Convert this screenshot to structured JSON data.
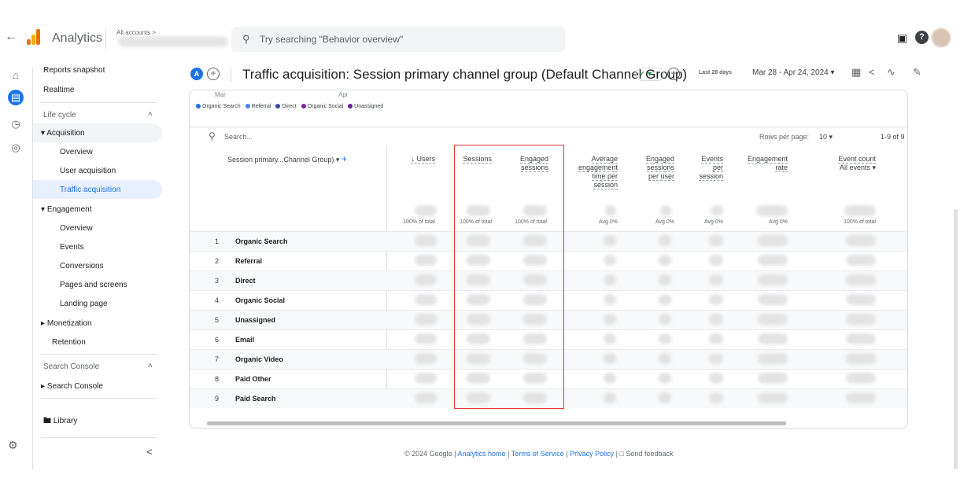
{
  "topbar": {
    "back": "←",
    "app_title": "Analytics",
    "accounts_label": "All accounts >",
    "search_placeholder": "Try searching \"Behavior overview\"",
    "search_icon": "search-icon",
    "help": "?"
  },
  "rail": {
    "icons": [
      "home-icon",
      "reports-icon",
      "explore-icon",
      "advertising-icon"
    ],
    "settings_icon": "gear-icon"
  },
  "sidenav": {
    "reports_snapshot": "Reports snapshot",
    "realtime": "Realtime",
    "lifecycle": "Life cycle",
    "acquisition": "Acquisition",
    "acq_overview": "Overview",
    "user_acquisition": "User acquisition",
    "traffic_acquisition": "Traffic acquisition",
    "engagement": "Engagement",
    "eng_overview": "Overview",
    "events": "Events",
    "conversions": "Conversions",
    "pages_and_screens": "Pages and screens",
    "landing_page": "Landing page",
    "monetization": "Monetization",
    "retention": "Retention",
    "search_console_head": "Search Console",
    "search_console": "Search Console",
    "library": "Library",
    "collapse": "<"
  },
  "header": {
    "badge": "A",
    "title": "Traffic acquisition: Session primary channel group (Default Channel Group)",
    "date_label": "Last 28 days",
    "date_range": "Mar 28 - Apr 24, 2024",
    "tools": [
      "edit-report-icon",
      "share-icon",
      "insights-icon",
      "pencil-icon"
    ]
  },
  "chart": {
    "x_ticks": [
      "Mar",
      "Apr"
    ],
    "legend": [
      {
        "label": "Organic Search",
        "color": "#1a73e8"
      },
      {
        "label": "Referral",
        "color": "#4285f4"
      },
      {
        "label": "Direct",
        "color": "#3949ab"
      },
      {
        "label": "Organic Social",
        "color": "#7b1fa2"
      },
      {
        "label": "Unassigned",
        "color": "#6a1b9a"
      }
    ]
  },
  "table": {
    "search_placeholder": "Search...",
    "rows_per_page_label": "Rows per page:",
    "rows_per_page_value": "10",
    "pagination": "1-9 of 9",
    "dimension_header": "Session primary...Channel Group)",
    "columns": {
      "users": "↓ Users",
      "sessions": "Sessions",
      "engaged_sessions": "Engaged sessions",
      "avg_engagement": "Average engagement time per session",
      "engaged_per_user": "Engaged sessions per user",
      "events_per_session": "Events per session",
      "engagement_rate": "Engagement rate",
      "event_count": "Event count",
      "event_count_filter": "All events ▾"
    },
    "totals": [
      "100% of total",
      "100% of total",
      "100% of total",
      "Avg 0%",
      "Avg 0%",
      "Avg 0%",
      "Avg 0%",
      "100% of total"
    ],
    "rows": [
      {
        "idx": "1",
        "name": "Organic Search"
      },
      {
        "idx": "2",
        "name": "Referral"
      },
      {
        "idx": "3",
        "name": "Direct"
      },
      {
        "idx": "4",
        "name": "Organic Social"
      },
      {
        "idx": "5",
        "name": "Unassigned"
      },
      {
        "idx": "6",
        "name": "Email"
      },
      {
        "idx": "7",
        "name": "Organic Video"
      },
      {
        "idx": "8",
        "name": "Paid Other"
      },
      {
        "idx": "9",
        "name": "Paid Search"
      }
    ]
  },
  "footer": {
    "copyright": "© 2024 Google | ",
    "analytics_home": "Analytics home",
    "sep1": " | ",
    "terms": "Terms of Service",
    "sep2": " | ",
    "privacy": "Privacy Policy",
    "sep3": " | ",
    "feedback": "Send feedback"
  },
  "highlight_color": "#e53935"
}
